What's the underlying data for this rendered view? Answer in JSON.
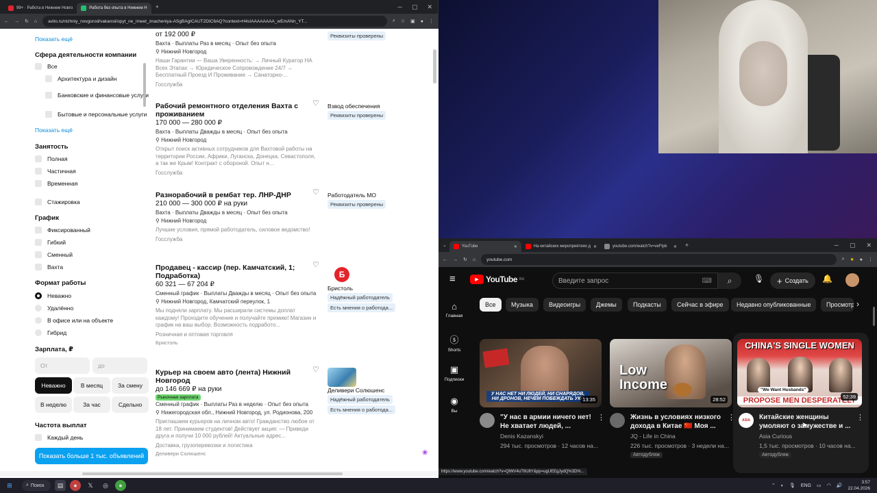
{
  "left_browser": {
    "tabs": [
      {
        "label": "99+ · Работа в Нижнем Новго",
        "active": false
      },
      {
        "label": "Работа без опыта в Нижнем Н",
        "active": true
      }
    ],
    "url": "avito.ru/nizhniy_novgorod/vakansii/opyt_ne_imeet_znacheniya-ASgBAgICAUT2DIC6AQ?context=H4sIAAAAAAAA_wEmANn_YT..."
  },
  "filters": {
    "show_more_top": "Показать ещё",
    "industry": {
      "title": "Сфера деятельности компании",
      "items": [
        "Все",
        "Архитектура и дизайн",
        "Банковские и финансовые услуги",
        "Бытовые и персональные услуги"
      ],
      "show_more": "Показать ещё"
    },
    "employment": {
      "title": "Занятость",
      "items": [
        "Полная",
        "Частичная",
        "Временная",
        "Стажировка"
      ]
    },
    "schedule": {
      "title": "График",
      "items": [
        "Фиксированный",
        "Гибкий",
        "Сменный",
        "Вахта"
      ]
    },
    "work_format": {
      "title": "Формат работы",
      "items": [
        "Неважно",
        "Удалённо",
        "В офисе или на объекте",
        "Гибрид"
      ],
      "selected": "Неважно"
    },
    "salary": {
      "title": "Зарплата, ₽",
      "from_placeholder": "От",
      "to_placeholder": "до",
      "periods": [
        "Неважно",
        "В месяц",
        "За смену",
        "В неделю",
        "За час",
        "Сдельно"
      ],
      "selected": "Неважно"
    },
    "pay_frequency": {
      "title": "Частота выплат",
      "items": [
        "Каждый день"
      ]
    },
    "show_results": "Показать больше 1 тыс. объявлений"
  },
  "listings": [
    {
      "title": "",
      "price": "от 192 000 ₽",
      "meta": "Вахта · Выплаты Раз в месяц · Опыт без опыта",
      "location": "Нижний Новгород",
      "desc": "Наши Гарантии — Ваша Уверенность: → Личный Куратор НА Всех Этапах → Юридическое Сопровождение 24/7 → Бесплатный Проезд И Проживание → Санаторно-...",
      "category": "Госслужба",
      "seller": "",
      "badges": [
        "Реквизиты проверены"
      ]
    },
    {
      "title": "Рабочий ремонтного отделения Вахта с проживанием",
      "price": "170 000 — 280 000 ₽",
      "meta": "Вахта · Выплаты Дважды в месяц · Опыт без опыта",
      "location": "Нижний Новгород",
      "desc": "Открыт поиск активных сотрудников для Вахтовой работы на территории России, Африки, Луганска, Донецка, Севастополя, а так же Крым! Контракт с обороной. Опыт н...",
      "category": "Госслужба",
      "seller": "Взвод обеспечения",
      "badges": [
        "Реквизиты проверены"
      ]
    },
    {
      "title": "Разнорабочий в рембат тер. ЛНР-ДНР",
      "price": "210 000 — 300 000 ₽ на руки",
      "meta": "Вахта · Выплаты Дважды в месяц · Опыт без опыта",
      "location": "Нижний Новгород",
      "desc": "Лучшие условия, прямой работодатель, силовое ведомство!",
      "category": "Госслужба",
      "seller": "Работодатель МО",
      "badges": [
        "Реквизиты проверены"
      ]
    },
    {
      "title": "Продавец - кассир (пер. Камчатский, 1; Подработка)",
      "price": "60 321 — 67 204 ₽",
      "meta": "Сменный график · Выплаты Дважды в месяц · Опыт без опыта",
      "location": "Нижний Новгород, Камчатский переулок, 1",
      "desc": "Мы подняли зарплату. Мы расширили системы доплат каждому! Проходите обучение и получайте премию! Магазин и график на ваш выбор. Возможность подработо...",
      "category": "Розничная и оптовая торговля",
      "company_link": "Бристоль",
      "seller": "Бристоль",
      "badges": [
        "Надёжный работодатель",
        "Есть мнения о работода..."
      ]
    },
    {
      "title": "Курьер на своем авто (лента) Нижний Новгород",
      "price": "до 146 669 ₽ на руки",
      "tag": "Рыночная зарплата",
      "meta": "Сменный график · Выплаты Раз в неделю · Опыт без опыта",
      "location": "Нижегородская обл., Нижний Новгород, ул. Родионова, 200",
      "desc": "Приглашаем курьеров на личном авто! Гражданство любое от 18 лет. Принимаем студентов! Действует акция: — Приведи друга и получи 10 000 рублей! Актуальные адрес...",
      "category": "Доставка, грузоперевозки и логистика",
      "company_link": "Деливери Солюшенс",
      "seller": "Деливери Солюшенс",
      "badges": [
        "Надёжный работодатель",
        "Есть мнения о работода..."
      ]
    }
  ],
  "youtube_browser": {
    "tabs": [
      "YouTube",
      "На китайских мероприятиях д",
      "youtube.com/watch?v=veFtpk"
    ],
    "url": "youtube.com"
  },
  "youtube": {
    "logo": "YouTube",
    "logo_sup": "RU",
    "search_placeholder": "Введите запрос",
    "create": "Создать",
    "sidebar": [
      "Главная",
      "Shorts",
      "Подписки",
      "Вы"
    ],
    "chips": [
      "Все",
      "Музыка",
      "Видеоигры",
      "Джемы",
      "Подкасты",
      "Сейчас в эфире",
      "Недавно опубликованные",
      "Просмотр"
    ],
    "videos": [
      {
        "thumb_text": "У НАС НЕТ НИ ЛЮДЕЙ, НИ СНАРЯДОВ, НИ ДРОНОВ, НЕЧЕМ ПОБЕЖДАТЬ УКР",
        "duration": "13:35",
        "title": "\"У нас в армии ничего нет! Не хватает людей, ...",
        "channel": "Denis Kazanskyi",
        "stats": "294 тыс. просмотров · 12 часов на..."
      },
      {
        "thumb_text": "Low Income",
        "duration": "28:52",
        "title": "Жизнь в условиях низкого дохода в Китае 🇨🇳 Моя ...",
        "channel": "JQ - Life in China",
        "stats": "226 тыс. просмотров · 3 недели на...",
        "dub": "Автодубляж"
      },
      {
        "thumb_text": "CHINA'S SINGLE WOMEN",
        "thumb_text2": "PROPOSE MEN DESPERATELY",
        "thumb_quote": "\"We Want Husbands\"",
        "duration": "52:39",
        "title": "Китайские женщины умоляют о замужестве и ...",
        "channel": "Asia Curious",
        "stats": "1,5 тыс. просмотров · 10 часов на...",
        "dub": "Автодубляж"
      }
    ]
  },
  "status_url": "https://www.youtube.com/watch?v=QlWV4uT6U8Y&pp=ugUEEgJydQ%3D%...",
  "taskbar": {
    "search": "Поиск",
    "lang": "ENG",
    "time": "3:57",
    "date": "22.04.2026"
  },
  "colors": {
    "avito_link": "#0a8bd8",
    "avito_button": "#0aa1f0",
    "youtube_bg": "#0f0f0f",
    "youtube_red": "#ff0000"
  }
}
